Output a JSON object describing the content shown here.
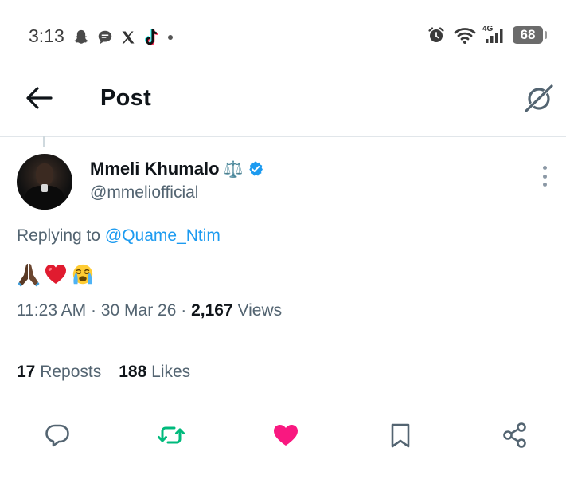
{
  "status_bar": {
    "time": "3:13",
    "network": "4G",
    "battery": "68",
    "left_icons": [
      "snapchat-icon",
      "chat-bubble-icon",
      "x-logo-icon",
      "tiktok-icon"
    ],
    "right_icons": [
      "alarm-icon",
      "wifi-icon",
      "signal-icon",
      "battery-icon"
    ]
  },
  "header": {
    "title": "Post",
    "back_icon": "arrow-left-icon",
    "grok_icon": "grok-icon"
  },
  "post": {
    "author_name": "Mmeli Khumalo",
    "name_emoji": "⚖️",
    "verified_color": "#1d9bf0",
    "handle": "@mmeliofficial",
    "replying_prefix": "Replying to",
    "replying_to": "@Quame_Ntim",
    "content_emojis": [
      "🙏🏿",
      "❤️",
      "😭"
    ],
    "time": "11:23 AM",
    "date": "30 Mar 26",
    "views_count": "2,167",
    "views_label": "Views",
    "reposts_count": "17",
    "reposts_label": "Reposts",
    "likes_count": "188",
    "likes_label": "Likes",
    "liked": true,
    "reposted": true
  },
  "actions": {
    "reply_icon": "reply-icon",
    "repost_icon": "repost-icon",
    "like_icon": "heart-icon",
    "bookmark_icon": "bookmark-icon",
    "share_icon": "share-icon",
    "repost_color": "#00ba7c",
    "like_color": "#f91880",
    "muted_color": "#536471"
  }
}
